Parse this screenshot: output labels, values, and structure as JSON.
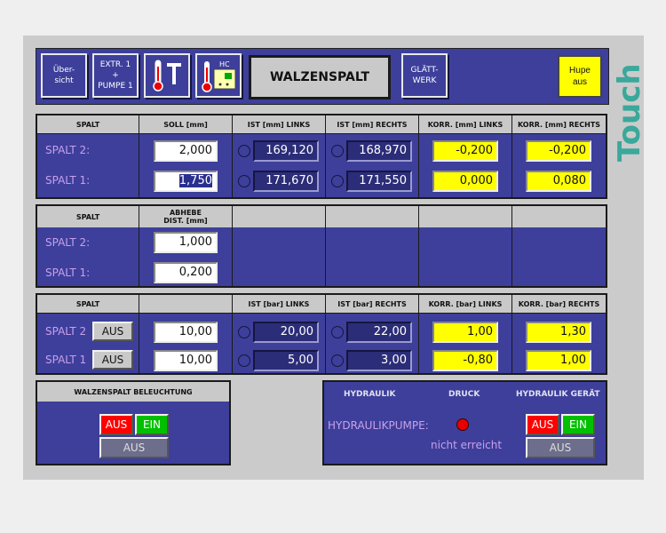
{
  "toolbar": {
    "overview_label": "Über-\nsicht",
    "extr_label": "EXTR. 1\n+\nPUMPE 1",
    "hc_label": "HC",
    "title": "WALZENSPALT",
    "glaett_label": "GLÄTT-\nWERK",
    "hupe_label": "Hupe\naus",
    "touch_label": "Touch"
  },
  "table1": {
    "headers": [
      "SPALT",
      "SOLL [mm]",
      "IST [mm] LINKS",
      "IST [mm] RECHTS",
      "KORR. [mm] LINKS",
      "KORR. [mm] RECHTS"
    ],
    "rows": [
      {
        "label": "SPALT 2:",
        "soll": "2,000",
        "ist_links": "169,120",
        "ist_rechts": "168,970",
        "korr_links": "-0,200",
        "korr_rechts": "-0,200"
      },
      {
        "label": "SPALT 1:",
        "soll": "1,750",
        "ist_links": "171,670",
        "ist_rechts": "171,550",
        "korr_links": "0,000",
        "korr_rechts": "0,080"
      }
    ]
  },
  "table2": {
    "headers": [
      "SPALT",
      "ABHEBE\nDIST. [mm]"
    ],
    "rows": [
      {
        "label": "SPALT 2:",
        "value": "1,000"
      },
      {
        "label": "SPALT 1:",
        "value": "0,200"
      }
    ]
  },
  "table3": {
    "headers": [
      "SPALT",
      "",
      "IST [bar] LINKS",
      "IST [bar] RECHTS",
      "KORR. [bar] LINKS",
      "KORR. [bar] RECHTS"
    ],
    "rows": [
      {
        "label": "SPALT 2",
        "toggle": "AUS",
        "soll": "10,00",
        "ist_links": "20,00",
        "ist_rechts": "22,00",
        "korr_links": "1,00",
        "korr_rechts": "1,30"
      },
      {
        "label": "SPALT 1",
        "toggle": "AUS",
        "soll": "10,00",
        "ist_links": "5,00",
        "ist_rechts": "3,00",
        "korr_links": "-0,80",
        "korr_rechts": "1,00"
      }
    ]
  },
  "lighting": {
    "title": "WALZENSPALT BELEUCHTUNG",
    "aus_label": "AUS",
    "ein_label": "EIN",
    "status": "AUS"
  },
  "hydraulik": {
    "col1": "HYDRAULIK",
    "col2": "DRUCK",
    "col3": "HYDRAULIK GERÄT",
    "pump_label": "HYDRAULIKPUMPE:",
    "pressure_status": "nicht erreicht",
    "aus_label": "AUS",
    "ein_label": "EIN",
    "status": "AUS"
  },
  "colors": {
    "panel": "#3d3f9b",
    "header": "#c9c9c9",
    "highlight": "#ffff00",
    "touch": "#3aa89a"
  },
  "icons": [
    "thermometer-t-icon",
    "thermometer-hc-icon",
    "pressure-lamp-icon"
  ]
}
